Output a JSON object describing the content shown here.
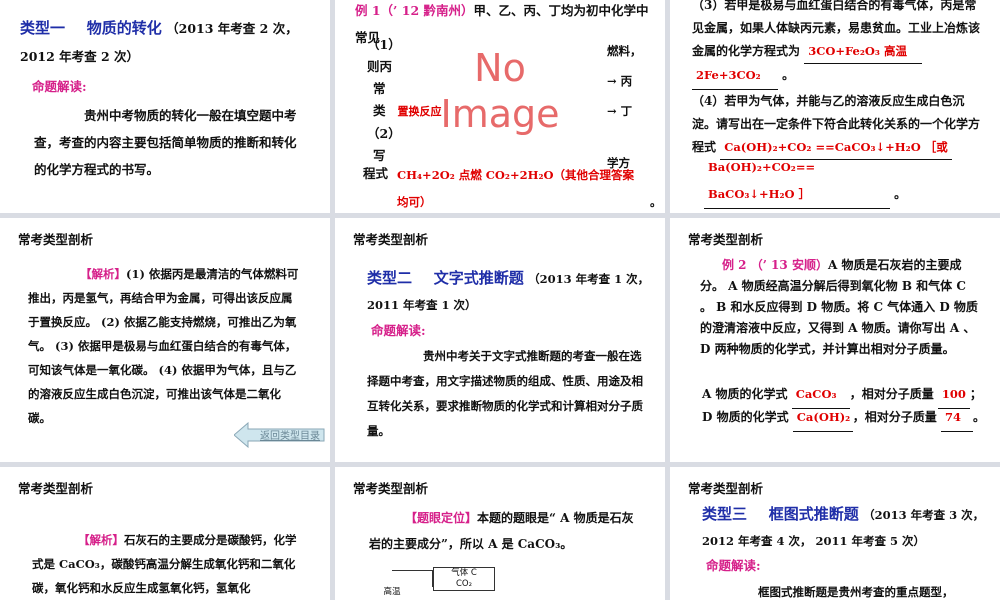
{
  "s1": {
    "title": "类型一",
    "title2": "物质的转化",
    "note": "（2013 年考查 2 次， 2012 年考查 2 次）",
    "sub": "命题解读:",
    "body": "贵州中考物质的转化一般在填空题中考查，考查的内容主要包括简单物质的推断和转化的化学方程式的书写。"
  },
  "s2": {
    "example": "例 1（’ 12 黔南州）",
    "lead": "甲、乙、丙、丁均为初中化学中常见",
    "q1": "（1）",
    "l1": "则丙",
    "l2": "常",
    "l3": "类",
    "answer1": "置换反应",
    "q2": "（2）",
    "l4": "写",
    "l5": "程式",
    "r1": "燃料，",
    "r2": "→ 丙",
    "r3": "→ 丁",
    "r4": "学方",
    "answer2": "CH₄+2O₂ 点燃 CO₂+2H₂O（其他合理答案均可）",
    "noimage": "No Image"
  },
  "s3": {
    "p1": "（3）若甲是极易与血红蛋白结合的有毒气体，丙是常见金属，如果人体缺丙元素，易患贫血。工业上冶炼该金属的化学方程式为",
    "ans3a": "3CO+Fe₂O₃ 高温",
    "ans3b": "2Fe+3CO₂",
    "p2": "（4）若甲为气体，并能与乙的溶液反应生成白色沉淀。请写出在一定条件下符合此转化关系的一个化学方程式",
    "ans4a": "Ca(OH)₂+CO₂ ==CaCO₃↓+H₂O ［或",
    "ans4b": "Ba(OH)₂+CO₂== BaCO₃↓+H₂O ］"
  },
  "s4": {
    "header": "常考类型剖析",
    "tag": "【解析】",
    "body": "(1) 依据丙是最清洁的气体燃料可推出，丙是氢气，再结合甲为金属，可得出该反应属于置换反应。 (2) 依据乙能支持燃烧，可推出乙为氧气。 (3) 依据甲是极易与血红蛋白结合的有毒气体，可知该气体是一氧化碳。 (4) 依据甲为气体，且与乙的溶液反应生成白色沉淀，可推出该气体是二氧化碳。",
    "back": "返回类型目录"
  },
  "s5": {
    "header": "常考类型剖析",
    "title": "类型二",
    "title2": "文字式推断题",
    "note": "（2013 年考查 1 次，2011 年考查 1 次）",
    "sub": "命题解读:",
    "body": "贵州中考关于文字式推断题的考查一般在选择题中考查，用文字描述物质的组成、性质、用途及相互转化关系，要求推断物质的化学式和计算相对分子质量。"
  },
  "s6": {
    "header": "常考类型剖析",
    "example": "例 2 （’ 13 安顺）",
    "body": "A 物质是石灰岩的主要成分。 A 物质经高温分解后得到氧化物 B 和气体 C 。 B 和水反应得到 D 物质。将 C 气体通入 D 物质的澄清溶液中反应，又得到 A 物质。请你写出 A 、 D 两种物质的化学式，并计算出相对分子质量。",
    "a_label": "A 物质的化学式",
    "a_formula": "CaCO₃",
    "a_mass_label": "，相对分子质量",
    "a_mass": "100",
    "d_label": "D 物质的化学式",
    "d_formula": "Ca(OH)₂",
    "d_mass_label": "，相对分子质量",
    "d_mass": "74"
  },
  "s7": {
    "header": "常考类型剖析",
    "tag": "【解析】",
    "body": "石灰石的主要成分是碳酸钙，化学式是 CaCO₃，碳酸钙高温分解生成氧化钙和二氧化碳，氧化钙和水反应生成氢氧化钙，氢氧化"
  },
  "s8": {
    "header": "常考类型剖析",
    "tag": "【题眼定位】",
    "body": "本题的题眼是“ A 物质是石灰岩的主要成分”，所以 A 是 CaCO₃。",
    "box1": "气体 C",
    "box1b": "CO₂",
    "box2": "高温"
  },
  "s9": {
    "header": "常考类型剖析",
    "title": "类型三",
    "title2": "框图式推断题",
    "note": "（2013 年考查 3 次， 2012 年考查 4 次， 2011 年考查 5 次）",
    "sub": "命题解读:",
    "body": "框图式推断题是贵州考查的重点题型，"
  }
}
